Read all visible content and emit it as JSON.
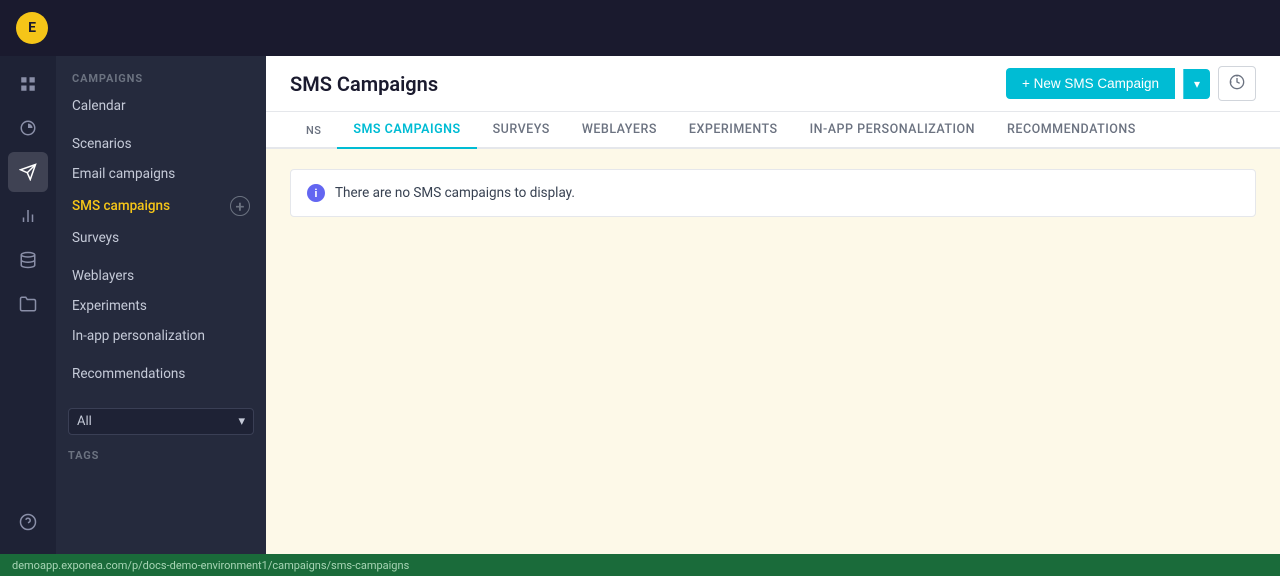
{
  "app": {
    "title": "SMS Campaigns"
  },
  "topbar": {
    "logo_text": "E"
  },
  "icon_sidebar": {
    "items": [
      {
        "name": "dashboard-icon",
        "icon": "⊞",
        "active": false
      },
      {
        "name": "analytics-icon",
        "icon": "📊",
        "active": false
      },
      {
        "name": "campaigns-icon",
        "icon": "📣",
        "active": true
      },
      {
        "name": "reports-icon",
        "icon": "📈",
        "active": false
      },
      {
        "name": "database-icon",
        "icon": "🗄",
        "active": false
      },
      {
        "name": "folder-icon",
        "icon": "📁",
        "active": false
      },
      {
        "name": "help-icon",
        "icon": "❓",
        "active": false
      }
    ]
  },
  "nav_sidebar": {
    "section_label": "CAMPAIGNS",
    "items": [
      {
        "label": "Calendar",
        "active": false,
        "has_plus": false
      },
      {
        "label": "Scenarios",
        "active": false,
        "has_plus": false
      },
      {
        "label": "Email campaigns",
        "active": false,
        "has_plus": false
      },
      {
        "label": "SMS campaigns",
        "active": true,
        "has_plus": true
      },
      {
        "label": "Surveys",
        "active": false,
        "has_plus": false
      },
      {
        "label": "Weblayers",
        "active": false,
        "has_plus": false
      },
      {
        "label": "Experiments",
        "active": false,
        "has_plus": false
      },
      {
        "label": "In-app personalization",
        "active": false,
        "has_plus": false
      },
      {
        "label": "Recommendations",
        "active": false,
        "has_plus": false
      }
    ],
    "filter": {
      "label": "All",
      "placeholder": "All"
    },
    "tags_label": "TAGS"
  },
  "header": {
    "title": "SMS Campaigns",
    "new_button_label": "+ New SMS Campaign"
  },
  "tabs": [
    {
      "label": "NS",
      "active": false
    },
    {
      "label": "SMS CAMPAIGNS",
      "active": true
    },
    {
      "label": "SURVEYS",
      "active": false
    },
    {
      "label": "WEBLAYERS",
      "active": false
    },
    {
      "label": "EXPERIMENTS",
      "active": false
    },
    {
      "label": "IN-APP PERSONALIZATION",
      "active": false
    },
    {
      "label": "RECOMMENDATIONS",
      "active": false
    }
  ],
  "main_content": {
    "empty_message": "There are no SMS campaigns to display."
  },
  "status_bar": {
    "url": "demoapp.exponea.com/p/docs-demo-environment1/campaigns/sms-campaigns"
  }
}
